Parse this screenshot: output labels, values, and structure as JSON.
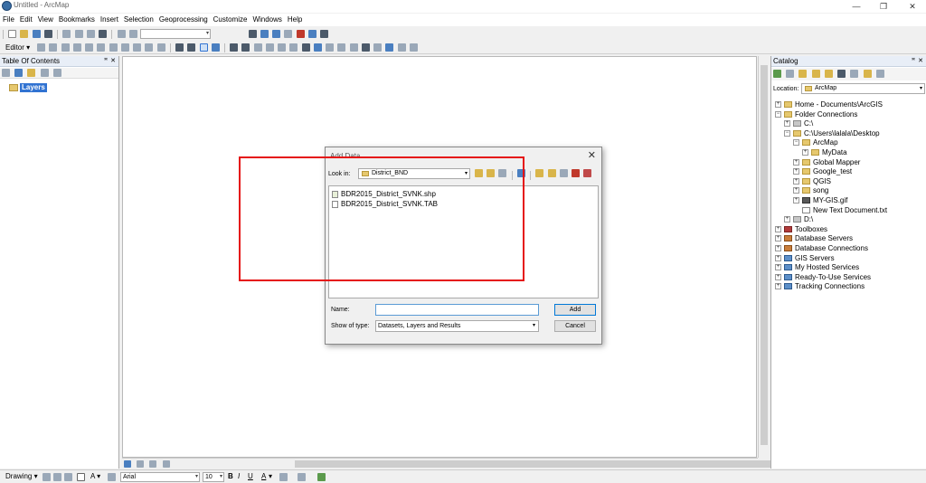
{
  "window": {
    "title": "Untitled - ArcMap",
    "controls": [
      "—",
      "❐",
      "✕"
    ]
  },
  "menu": [
    "File",
    "Edit",
    "View",
    "Bookmarks",
    "Insert",
    "Selection",
    "Geoprocessing",
    "Customize",
    "Windows",
    "Help"
  ],
  "editor_toolbar": {
    "label": "Editor ▾"
  },
  "toc": {
    "title": "Table Of Contents",
    "root_layer": "Layers"
  },
  "catalog": {
    "title": "Catalog",
    "location_label": "Location:",
    "location_value": "ArcMap",
    "tree": [
      {
        "indent": 0,
        "exp": "+",
        "icon": "folder",
        "label": "Home - Documents\\ArcGIS"
      },
      {
        "indent": 0,
        "exp": "−",
        "icon": "folder",
        "label": "Folder Connections"
      },
      {
        "indent": 1,
        "exp": "+",
        "icon": "drive",
        "label": "C:\\"
      },
      {
        "indent": 1,
        "exp": "−",
        "icon": "folder",
        "label": "C:\\Users\\lalala\\Desktop"
      },
      {
        "indent": 2,
        "exp": "−",
        "icon": "folder",
        "label": "ArcMap"
      },
      {
        "indent": 3,
        "exp": "+",
        "icon": "folder",
        "label": "MyData"
      },
      {
        "indent": 2,
        "exp": "+",
        "icon": "folder",
        "label": "Global Mapper"
      },
      {
        "indent": 2,
        "exp": "+",
        "icon": "folder",
        "label": "Google_test"
      },
      {
        "indent": 2,
        "exp": "+",
        "icon": "folder",
        "label": "QGIS"
      },
      {
        "indent": 2,
        "exp": "+",
        "icon": "folder",
        "label": "song"
      },
      {
        "indent": 2,
        "exp": "+",
        "icon": "grid",
        "label": "MY-GIS.gif"
      },
      {
        "indent": 2,
        "exp": "",
        "icon": "doc",
        "label": "New Text Document.txt"
      },
      {
        "indent": 1,
        "exp": "+",
        "icon": "drive",
        "label": "D:\\"
      },
      {
        "indent": 0,
        "exp": "+",
        "icon": "tool",
        "label": "Toolboxes"
      },
      {
        "indent": 0,
        "exp": "+",
        "icon": "db",
        "label": "Database Servers"
      },
      {
        "indent": 0,
        "exp": "+",
        "icon": "db",
        "label": "Database Connections"
      },
      {
        "indent": 0,
        "exp": "+",
        "icon": "srv",
        "label": "GIS Servers"
      },
      {
        "indent": 0,
        "exp": "+",
        "icon": "srv",
        "label": "My Hosted Services"
      },
      {
        "indent": 0,
        "exp": "+",
        "icon": "srv",
        "label": "Ready-To-Use Services"
      },
      {
        "indent": 0,
        "exp": "+",
        "icon": "srv",
        "label": "Tracking Connections"
      }
    ]
  },
  "dialog": {
    "title": "Add Data",
    "close": "✕",
    "look_in_label": "Look in:",
    "look_in_value": "District_BND",
    "files": [
      {
        "icon": "shp",
        "name": "BDR2015_District_SVNK.shp"
      },
      {
        "icon": "tab",
        "name": "BDR2015_District_SVNK.TAB"
      }
    ],
    "name_label": "Name:",
    "name_value": "",
    "show_type_label": "Show of type:",
    "show_type_value": "Datasets, Layers and Results",
    "add_button": "Add",
    "cancel_button": "Cancel"
  },
  "drawing_toolbar": {
    "label": "Drawing ▾",
    "font_name": "Arial",
    "font_size": "10",
    "bold": "B",
    "italic": "I",
    "underline": "U",
    "font_color_glyph": "A"
  },
  "colors": {
    "highlight": "#3173d2",
    "annotation_box": "#e51414"
  }
}
